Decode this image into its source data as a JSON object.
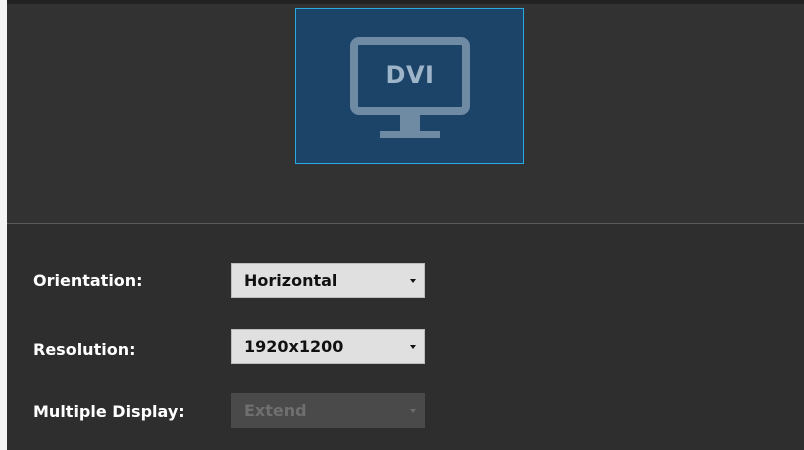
{
  "display": {
    "connector_label": "DVI",
    "accent_color": "#2aa8e0",
    "tile_color": "#1b4468",
    "icon": "monitor-icon"
  },
  "settings": {
    "orientation": {
      "label": "Orientation:",
      "value": "Horizontal"
    },
    "resolution": {
      "label": "Resolution:",
      "value": "1920x1200"
    },
    "multiple_display": {
      "label": "Multiple Display:",
      "value": "Extend",
      "disabled": true
    }
  }
}
